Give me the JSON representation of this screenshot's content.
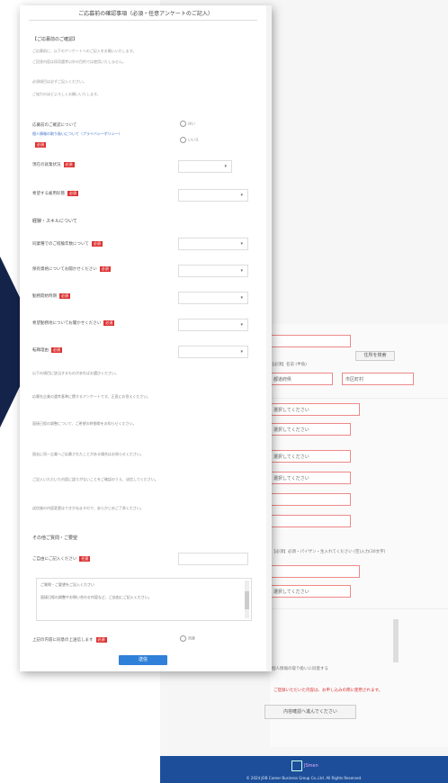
{
  "background_page": {
    "fields": [
      {
        "label": "",
        "value": ""
      },
      {
        "label": "【必須】名前 (半角)",
        "value": ""
      },
      {
        "label": "",
        "value": "都道府県"
      },
      {
        "label": "",
        "value": "市区町村"
      },
      {
        "label": "",
        "value": "選択してください"
      },
      {
        "label": "",
        "value": "選択してください"
      },
      {
        "label": "",
        "value": "選択してください"
      },
      {
        "label": "",
        "value": "選択してください"
      },
      {
        "label": "【必須】必須・パイザン・生入れてください (空)入力(30文字)",
        "value": ""
      },
      {
        "label": "",
        "value": "選択してください"
      }
    ],
    "lookup_button": "住所を検索",
    "agree_text": "個人情報の取り扱いに同意する",
    "warning_text": "ご登録いただいた内容は、お申し込みの際に使用されます。",
    "confirm_button": "内容確認へ進んでください",
    "footer": {
      "logo_text": "JSmen",
      "copyright": "© 2024 JOB Career Business Group Co.,Ltd. All Rights Reserved."
    }
  },
  "modal": {
    "title": "ご応募前の確認事項（必須・任意アンケートのご記入）",
    "intro_heading": "【ご応募前のご確認】",
    "intro_lines": [
      "ご応募前に、以下のアンケートへのご記入をお願いいたします。",
      "ご回答内容は採用選考以外の目的では使用いたしません。",
      "必須項目は必ずご記入ください。",
      "ご協力のほどよろしくお願いいたします。"
    ],
    "q1": {
      "label": "応募前のご確認について",
      "link": "個人情報の取り扱いについて（プライバシーポリシー）",
      "required": "必須",
      "options": [
        "はい",
        "いいえ"
      ]
    },
    "q2": {
      "label": "現在の就業状況",
      "required": "必須"
    },
    "q3": {
      "label": "希望する雇用形態",
      "required": "必須"
    },
    "section2": "経験・スキルについて",
    "questions": [
      {
        "label": "同業種でのご経験年数について",
        "required": "必須"
      },
      {
        "label": "保有資格についてお聞かせください",
        "required": "必須"
      },
      {
        "label": "勤務開始時期",
        "required": "必須"
      },
      {
        "label": "希望勤務地についてお聞かせください",
        "required": "必須"
      },
      {
        "label": "転職理由",
        "required": "必須"
      }
    ],
    "statements": [
      "以下の項目に該当するものがあればお選びください。",
      "応募先企業の選考基準に関するアンケートです。正直にお答えください。",
      "面接日程の調整について、ご希望の時間帯をお知らせください。",
      "過去に同一企業へご応募されたことがある場合はお知らせください。",
      "ご記入いただいた内容に誤りがないことをご確認のうえ、送信してください。",
      "送信後の内容変更はできかねますので、あらかじめご了承ください。"
    ],
    "free_section": "その他ご質問・ご要望",
    "free_label": "ご自由にご記入ください",
    "free_required": "任意",
    "textbox_line1": "ご質問・ご要望をご記入ください",
    "textbox_line2": "面接日程の調整やお問い合わせ内容など、ご自由にご記入ください。",
    "consent_label": "上記の内容に同意の上送信します",
    "consent_required": "必須",
    "consent_option": "同意",
    "submit_label": "送信"
  },
  "colors": {
    "accent": "#2f80d8",
    "footer": "#1c4e9a",
    "arrow": "#13234a",
    "required": "#d33333",
    "field_border": "#e88888"
  }
}
